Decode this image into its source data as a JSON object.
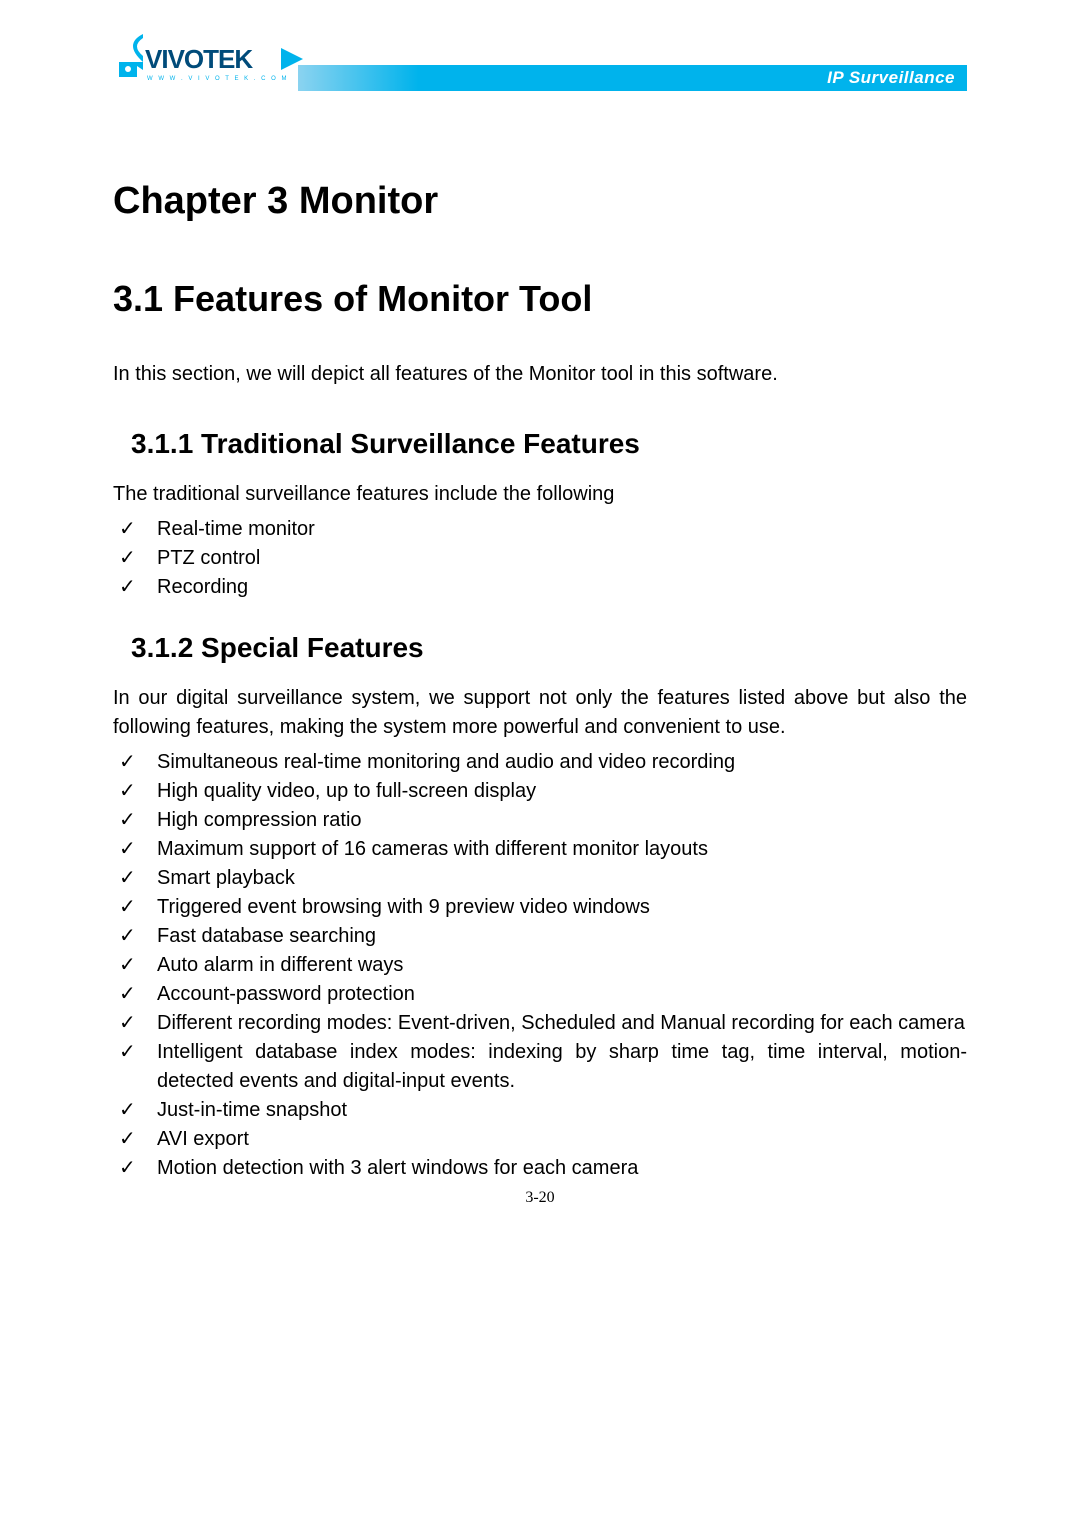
{
  "header": {
    "brand": "VIVOTEK",
    "brand_sub": "www.vivotek.com",
    "banner_text": "IP Surveillance"
  },
  "chapter_title": "Chapter 3 Monitor",
  "section_title": "3.1  Features of Monitor Tool",
  "intro": "In this section, we will depict all features of the Monitor tool in this software.",
  "sub1": {
    "title": "3.1.1 Traditional Surveillance Features",
    "lead": "The traditional surveillance features include the following",
    "items": [
      "Real-time monitor",
      "PTZ control",
      "Recording"
    ]
  },
  "sub2": {
    "title": "3.1.2  Special Features",
    "lead": "In our digital surveillance system, we support not only the features listed above but also the following features, making the system more powerful and convenient to use.",
    "items": [
      "Simultaneous real-time monitoring and audio and video recording",
      "High quality video, up to full-screen display",
      "High compression ratio",
      "Maximum support of 16 cameras with different monitor layouts",
      "Smart playback",
      "Triggered event browsing with 9 preview video windows",
      "Fast database searching",
      "Auto alarm in different ways",
      "Account-password protection",
      "Different recording modes: Event-driven, Scheduled and Manual recording for each camera",
      "Intelligent database index modes: indexing by sharp time tag, time interval, motion-detected events and digital-input events.",
      "Just-in-time snapshot",
      "AVI export",
      "Motion detection with 3 alert windows for each camera"
    ]
  },
  "page_number": "3-20"
}
